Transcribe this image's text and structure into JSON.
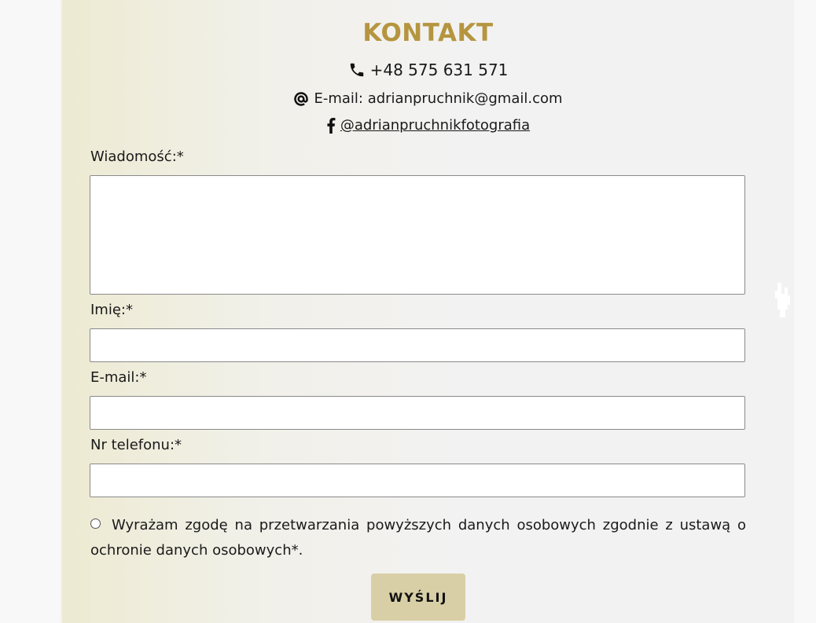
{
  "contact": {
    "title": "KONTAKT",
    "phone": "+48 575 631 571",
    "email_text": "E-mail: adrianpruchnik@gmail.com",
    "facebook": "@adrianpruchnikfotografia"
  },
  "form": {
    "message_label": "Wiadomość:*",
    "name_label": "Imię:*",
    "email_label": "E-mail:*",
    "phone_label": "Nr telefonu:*",
    "message_value": "",
    "name_value": "",
    "email_value": "",
    "phone_value": "",
    "consent": "Wyrażam zgodę na przetwarzania powyższych danych osobowych zgodnie z ustawą o ochronie danych osobowych*.",
    "consent_checked": false,
    "submit_label": "WYŚLIJ"
  },
  "colors": {
    "accent": "#b5953f",
    "button": "#d9cfa6"
  },
  "icons": [
    "phone-icon",
    "at-icon",
    "facebook-icon",
    "hand-cursor-icon"
  ]
}
